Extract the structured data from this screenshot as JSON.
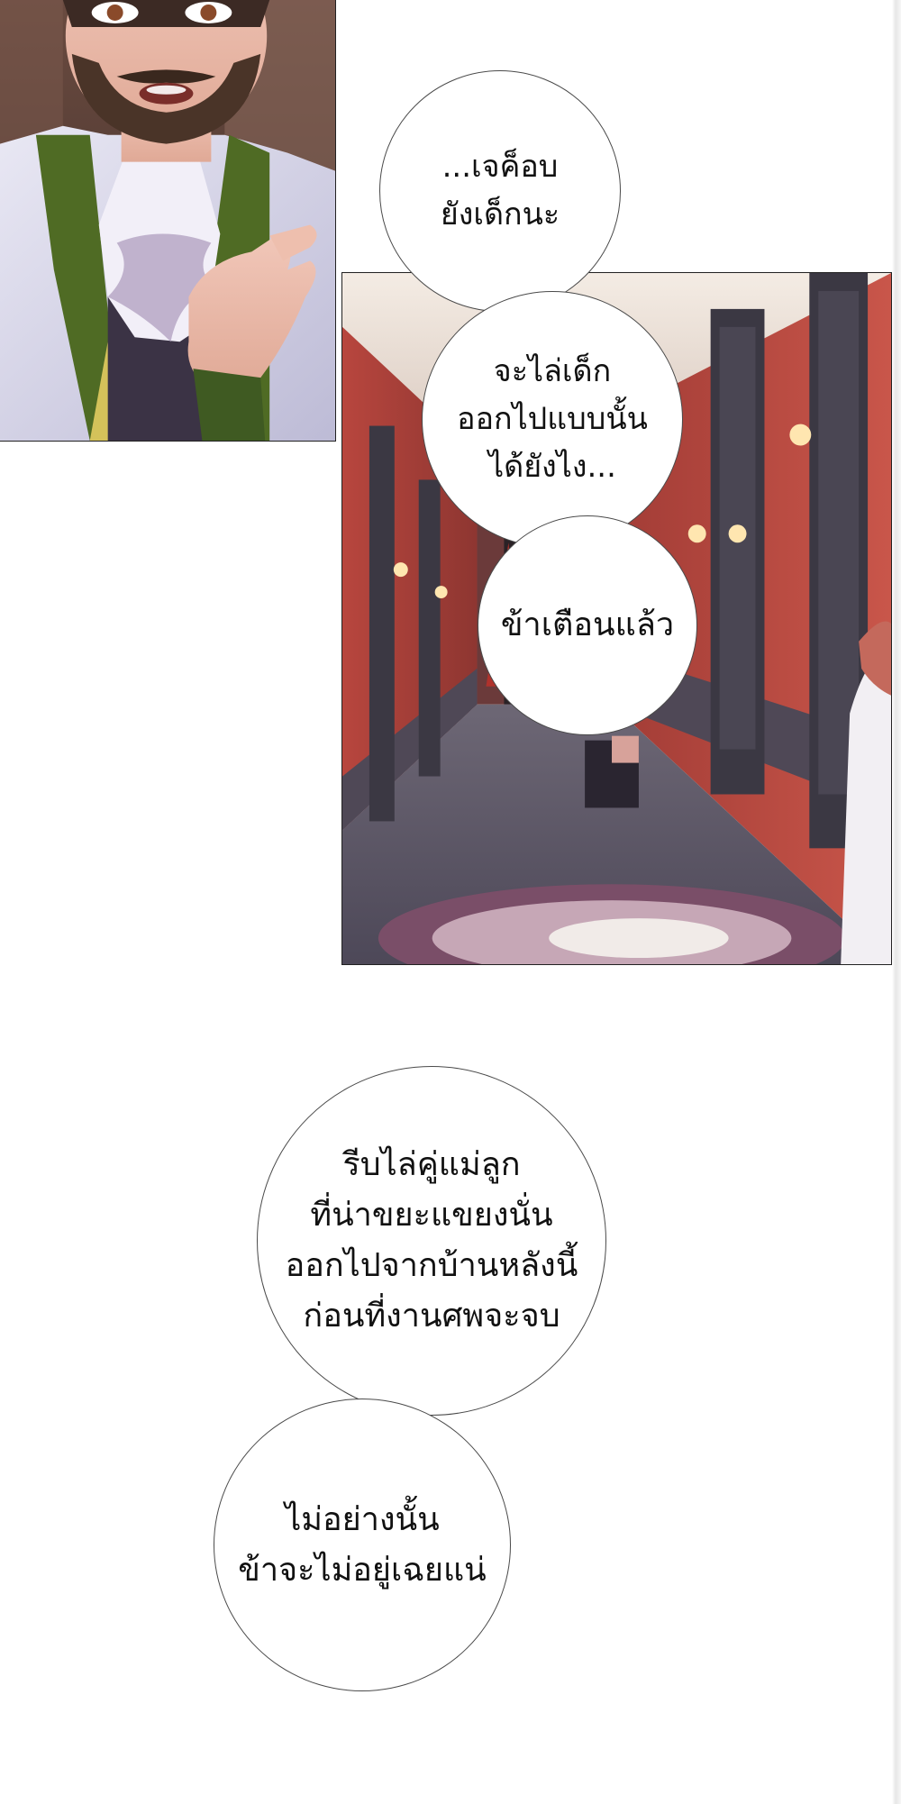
{
  "panels": [
    {
      "name": "bearded-man-panel",
      "description_icon": "bearded-man-illustration"
    },
    {
      "name": "hallway-panel",
      "description_icon": "red-hallway-illustration"
    }
  ],
  "dialogue": {
    "bubble_1": "...เจค็อบ\nยังเด็กนะ",
    "bubble_2": "จะไล่เด็ก\nออกไปแบบนั้น\nได้ยังไง...",
    "bubble_3": "ข้าเตือนแล้ว",
    "bubble_4": "รีบไล่คู่แม่ลูก\nที่น่าขยะแขยงนั่น\nออกไปจากบ้านหลังนี้\nก่อนที่งานศพจะจบ",
    "bubble_5": "ไม่อย่างนั้น\nข้าจะไม่อยู่เฉยแน่"
  },
  "colors": {
    "page_background": "#ffffff",
    "wall_red": "#b8463e",
    "coat_green": "#4f6b24",
    "bubble_fill": "#ffffff"
  }
}
